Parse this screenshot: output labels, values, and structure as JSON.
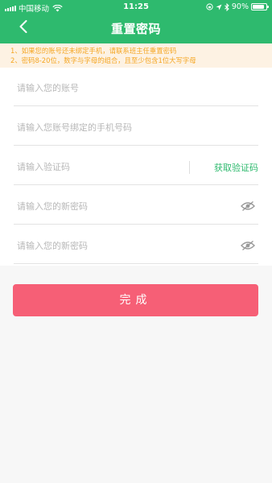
{
  "status_bar": {
    "carrier": "中国移动",
    "time": "11:25",
    "battery": "90%",
    "battery_level": 0.9
  },
  "header": {
    "title": "重置密码",
    "back_icon": "chevron-left-icon",
    "background": "#2eba6e"
  },
  "notice": {
    "line1": "1、如果您的账号还未绑定手机，请联系班主任重置密码",
    "line2": "2、密码8-20位，数字与字母的组合，且至少包含1位大写字母",
    "color": "#f5a623",
    "background": "#fdf2e3"
  },
  "form": {
    "account_placeholder": "请输入您的账号",
    "phone_placeholder": "请输入您账号绑定的手机号码",
    "code_placeholder": "请输入验证码",
    "get_code_label": "获取验证码",
    "new_password_placeholder": "请输入您的新密码",
    "confirm_password_placeholder": "请输入您的新密码",
    "eye_icon": "eye-off-icon"
  },
  "submit": {
    "label": "完成",
    "color": "#f65f76"
  }
}
